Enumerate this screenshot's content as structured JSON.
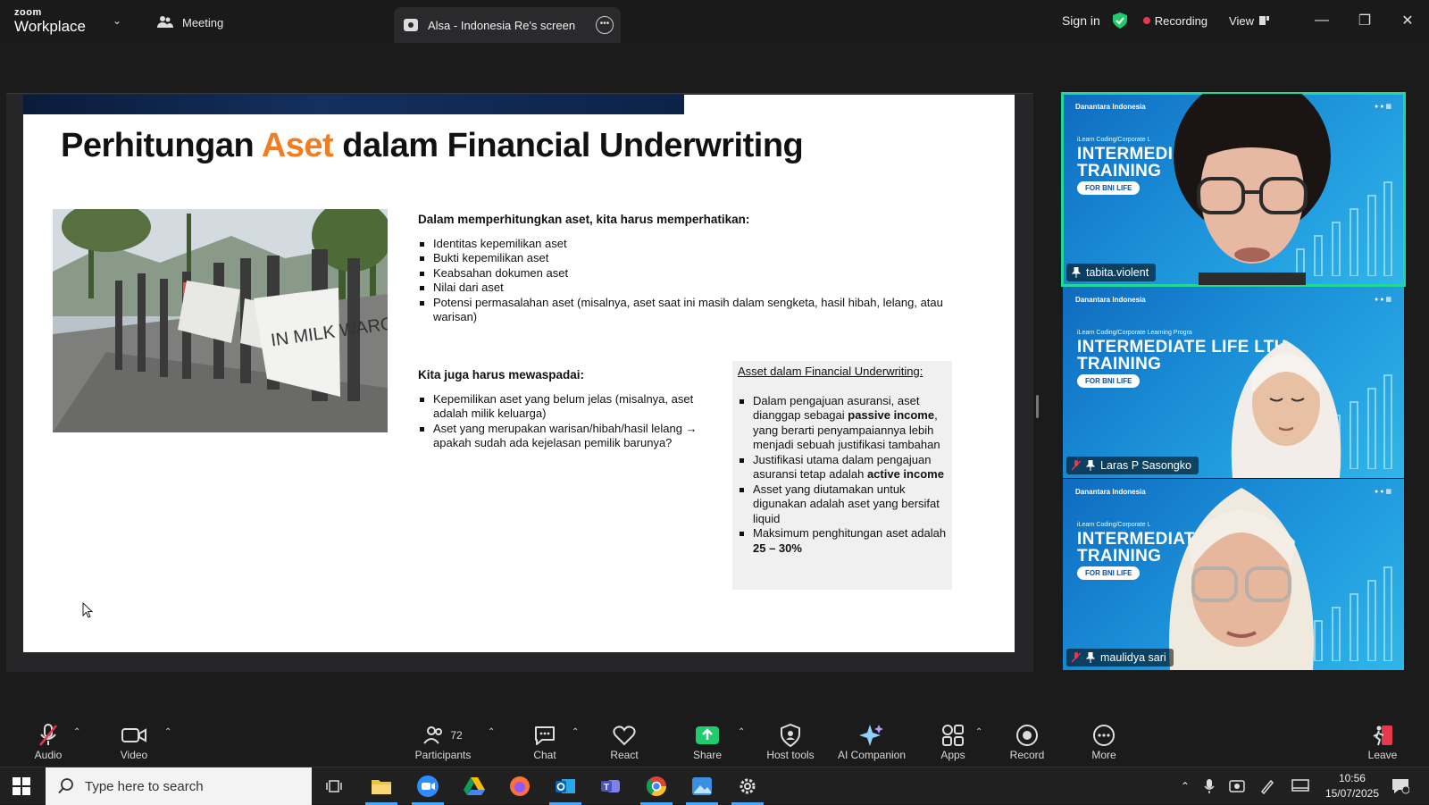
{
  "titlebar": {
    "logo_top": "zoom",
    "logo_bottom": "Workplace",
    "meeting_tab": "Meeting",
    "screen_tab": "Alsa - Indonesia Re's screen",
    "sign_in": "Sign in",
    "recording": "Recording",
    "view": "View"
  },
  "slide": {
    "title_pre": "Perhitungan ",
    "title_accent": "Aset",
    "title_post": " dalam Financial Underwriting",
    "section1_heading": "Dalam memperhitungkan aset, kita harus memperhatikan:",
    "section1_items": [
      "Identitas kepemilikan aset",
      "Bukti kepemilikan aset",
      "Keabsahan dokumen aset",
      "Nilai dari aset",
      "Potensi permasalahan aset (misalnya, aset saat ini masih dalam sengketa, hasil hibah, lelang, atau warisan)"
    ],
    "section2_heading": "Kita juga harus mewaspadai:",
    "section2_items": [
      "Kepemilikan aset yang belum jelas (misalnya, aset adalah milik keluarga)",
      "Aset yang merupakan warisan/hibah/hasil lelang → apakah sudah ada kejelasan pemilik barunya?"
    ],
    "box_heading": "Asset dalam Financial Underwriting:",
    "box_item1_pre": "Dalam pengajuan asuransi, aset dianggap sebagai ",
    "box_item1_bold": "passive income",
    "box_item1_post": ", yang berarti penyampaiannya lebih menjadi sebuah justifikasi tambahan",
    "box_item2_pre": "Justifikasi utama dalam pengajuan asuransi tetap adalah ",
    "box_item2_bold": "active income",
    "box_item3": "Asset yang diutamakan untuk digunakan adalah aset yang bersifat liquid",
    "box_item4_pre": "Maksimum penghitungan aset adalah ",
    "box_item4_bold": "25 – 30%",
    "photo_sign": "IN MILK WARGA"
  },
  "tiles": [
    {
      "name": "tabita.violent",
      "big1": "INTERMEDIATE",
      "big2": "TRAINING",
      "pill": "FOR BNI LIFE",
      "brand_l": "Danantara Indonesia",
      "prog": "iLearn Coding/Corporate L"
    },
    {
      "name": "Laras P Sasongko",
      "big1": "INTERMEDIATE LIFE    LTH",
      "big2": "TRAINING",
      "pill": "FOR BNI LIFE",
      "brand_l": "Danantara Indonesia",
      "prog": "iLearn Coding/Corporate Learning Progra"
    },
    {
      "name": "maulidya sari",
      "big1": "INTERMEDIAT       TH",
      "big2": "TRAINING",
      "pill": "FOR BNI LIFE",
      "brand_l": "Danantara Indonesia",
      "prog": "iLearn Coding/Corporate L"
    }
  ],
  "toolbar": {
    "audio": "Audio",
    "video": "Video",
    "participants": "Participants",
    "participants_count": "72",
    "chat": "Chat",
    "react": "React",
    "share": "Share",
    "host_tools": "Host tools",
    "ai_companion": "AI Companion",
    "apps": "Apps",
    "record": "Record",
    "more": "More",
    "leave": "Leave"
  },
  "taskbar": {
    "search_placeholder": "Type here to search",
    "time": "10:56",
    "date": "15/07/2025"
  },
  "colors": {
    "accent_orange": "#f07d22",
    "active_speaker": "#1fd99a",
    "share_green": "#1fcb6b",
    "recording_red": "#e8384f"
  }
}
